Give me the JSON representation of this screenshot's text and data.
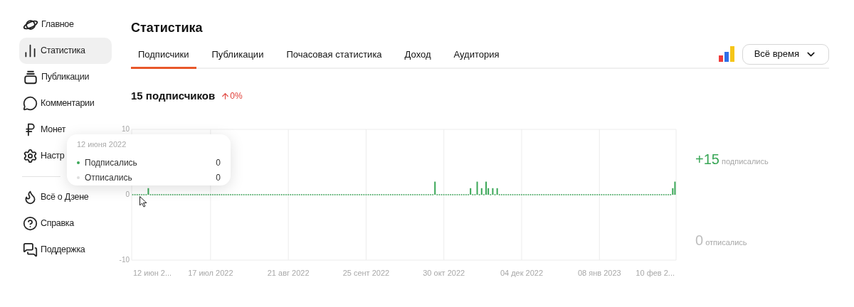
{
  "sidebar": {
    "items": [
      {
        "label": "Главное",
        "selected": false
      },
      {
        "label": "Статистика",
        "selected": true
      },
      {
        "label": "Публикации",
        "selected": false
      },
      {
        "label": "Комментарии",
        "selected": false
      },
      {
        "label": "Монет",
        "selected": false
      },
      {
        "label": "Настр",
        "selected": false
      }
    ],
    "secondary_items": [
      {
        "label": "Всё о Дзене",
        "selected": false
      },
      {
        "label": "Справка",
        "selected": false
      },
      {
        "label": "Поддержка",
        "selected": false
      }
    ]
  },
  "header": {
    "title": "Статистика",
    "tabs": [
      {
        "label": "Подписчики",
        "selected": true
      },
      {
        "label": "Публикации",
        "selected": false
      },
      {
        "label": "Почасовая статистика",
        "selected": false
      },
      {
        "label": "Доход",
        "selected": false
      },
      {
        "label": "Аудитория",
        "selected": false
      }
    ],
    "period_button": "Всё время"
  },
  "summary": {
    "count": "15 подписчиков",
    "change": "0%"
  },
  "chart": {
    "x_axis_labels": [
      "12 июн 2...",
      "17 июл 2022",
      "21 авг 2022",
      "25 сент 2022",
      "30 окт 2022",
      "04 дек 2022",
      "08 янв 2023",
      "10 фев 2..."
    ],
    "chart_data": {
      "type": "bar",
      "ylim": [
        -10,
        10
      ],
      "yticks": [
        -10,
        0,
        10
      ],
      "values": [
        0,
        0,
        0,
        0,
        0,
        0,
        0,
        1,
        0,
        0,
        0,
        0,
        0,
        0,
        0,
        0,
        0,
        0,
        0,
        0,
        0,
        0,
        0,
        0,
        0,
        0,
        0,
        0,
        0,
        0,
        0,
        0,
        0,
        0,
        0,
        0,
        0,
        0,
        0,
        0,
        0,
        0,
        0,
        0,
        0,
        0,
        0,
        0,
        0,
        0,
        0,
        0,
        0,
        0,
        0,
        0,
        0,
        0,
        0,
        0,
        0,
        0,
        0,
        0,
        0,
        0,
        0,
        0,
        0,
        0,
        0,
        0,
        0,
        0,
        0,
        0,
        0,
        0,
        0,
        0,
        0,
        0,
        0,
        0,
        0,
        0,
        0,
        0,
        0,
        0,
        0,
        0,
        0,
        0,
        0,
        0,
        0,
        0,
        0,
        0,
        0,
        0,
        0,
        0,
        0,
        0,
        0,
        0,
        0,
        0,
        0,
        0,
        0,
        0,
        0,
        0,
        0,
        0,
        0,
        0,
        0,
        0,
        0,
        0,
        0,
        0,
        0,
        0,
        0,
        0,
        0,
        0,
        0,
        0,
        0,
        0,
        2,
        0,
        0,
        0,
        0,
        0,
        0,
        0,
        0,
        0,
        0,
        0,
        0,
        0,
        0,
        0,
        1,
        0,
        0,
        2,
        0,
        1,
        0,
        2,
        1,
        0,
        1,
        0,
        1,
        0,
        0,
        0,
        0,
        0,
        0,
        0,
        0,
        0,
        0,
        0,
        0,
        0,
        0,
        0,
        0,
        0,
        0,
        0,
        0,
        0,
        0,
        0,
        0,
        0,
        0,
        0,
        0,
        0,
        0,
        0,
        0,
        0,
        0,
        0,
        0,
        0,
        0,
        0,
        0,
        0,
        0,
        0,
        0,
        0,
        0,
        0,
        0,
        0,
        0,
        0,
        0,
        0,
        0,
        0,
        0,
        0,
        0,
        0,
        0,
        0,
        0,
        0,
        0,
        0,
        0,
        0,
        0,
        0,
        0,
        0,
        0,
        0,
        0,
        0,
        0,
        0,
        0,
        1,
        2
      ]
    },
    "tooltip": {
      "date": "12 июня 2022",
      "rows": [
        {
          "label": "Подписались",
          "value": "0",
          "color": "#3aa757"
        },
        {
          "label": "Отписались",
          "value": "0",
          "color": "#dddddd"
        }
      ]
    }
  },
  "totals": [
    {
      "value": "+15",
      "label": "подписались",
      "color": "#3aa757"
    },
    {
      "value": "0",
      "label": "отписались",
      "color": "#bdbdbd"
    }
  ]
}
